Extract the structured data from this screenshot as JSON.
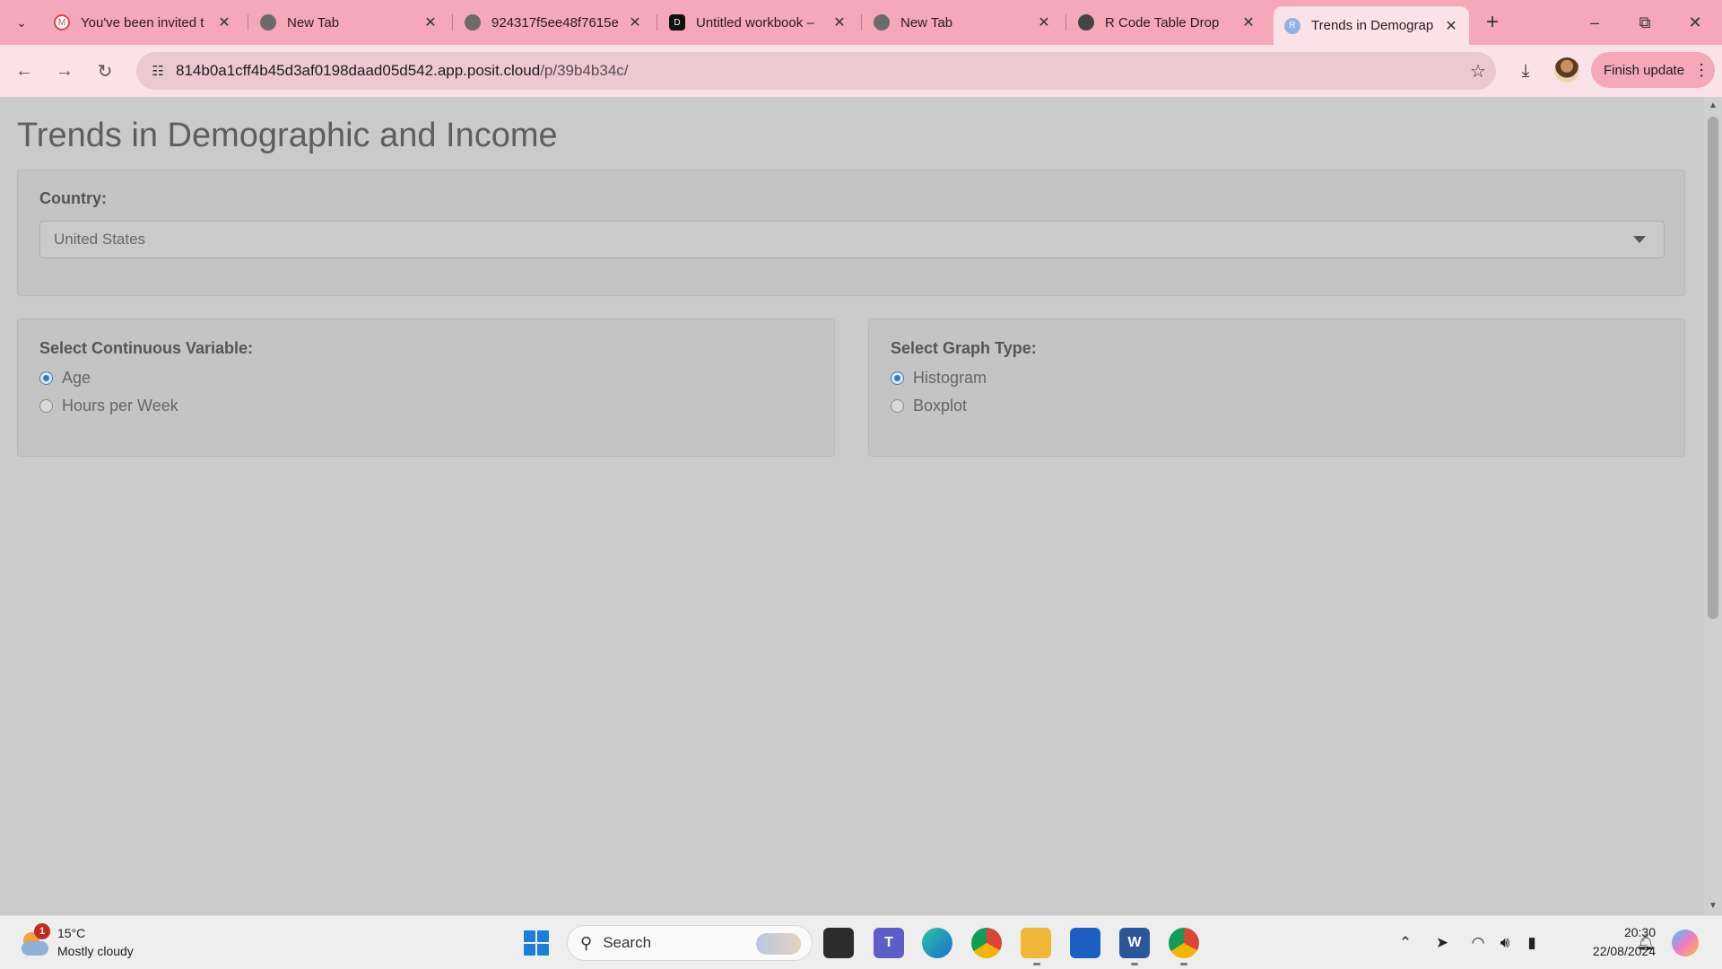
{
  "browser": {
    "tabs": [
      {
        "title": "You've been invited t",
        "favicon": "gmail-icon",
        "active": false
      },
      {
        "title": "New Tab",
        "favicon": "chrome-icon",
        "active": false
      },
      {
        "title": "924317f5ee48f7615e",
        "favicon": "globe-icon",
        "active": false
      },
      {
        "title": "Untitled workbook –",
        "favicon": "workbook-icon",
        "active": false
      },
      {
        "title": "New Tab",
        "favicon": "chrome-icon",
        "active": false
      },
      {
        "title": "R Code Table Drop",
        "favicon": "openai-icon",
        "active": false
      },
      {
        "title": "Trends in Demograp",
        "favicon": "r-icon",
        "active": true
      }
    ],
    "url_host": "814b0a1cff4b45d3af0198daad05d542.app.posit.cloud",
    "url_path": "/p/39b4b34c/",
    "finish_update_label": "Finish update"
  },
  "app": {
    "title": "Trends in Demographic and Income",
    "country": {
      "label": "Country:",
      "selected": "United States"
    },
    "continuous_variable": {
      "label": "Select Continuous Variable:",
      "options": [
        {
          "label": "Age",
          "checked": true
        },
        {
          "label": "Hours per Week",
          "checked": false
        }
      ]
    },
    "graph_type": {
      "label": "Select Graph Type:",
      "options": [
        {
          "label": "Histogram",
          "checked": true
        },
        {
          "label": "Boxplot",
          "checked": false
        }
      ]
    }
  },
  "taskbar": {
    "weather": {
      "temp": "15°C",
      "desc": "Mostly cloudy",
      "badge": "1"
    },
    "search_placeholder": "Search",
    "clock": {
      "time": "20:30",
      "date": "22/08/2024"
    }
  }
}
